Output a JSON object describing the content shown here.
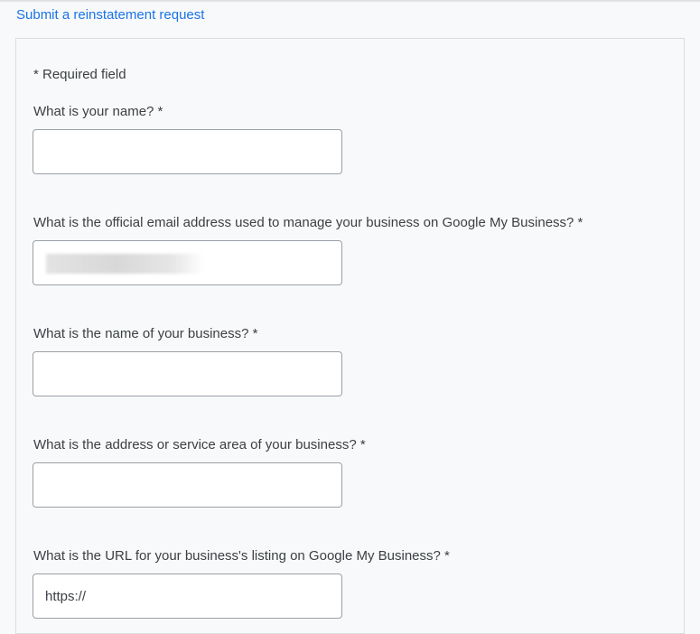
{
  "header": {
    "link_text": "Submit a reinstatement request"
  },
  "form": {
    "required_note": "* Required field",
    "fields": [
      {
        "label": "What is your name? *",
        "value": ""
      },
      {
        "label": "What is the official email address used to manage your business on Google My Business? *",
        "value": ""
      },
      {
        "label": "What is the name of your business? *",
        "value": ""
      },
      {
        "label": "What is the address or service area of your business? *",
        "value": ""
      },
      {
        "label": "What is the URL for your business's listing on Google My Business? *",
        "value": "https://"
      }
    ]
  },
  "colors": {
    "link": "#1a73e8",
    "text": "#3c4043",
    "border": "#9aa0a6",
    "background": "#f8f9fa"
  }
}
